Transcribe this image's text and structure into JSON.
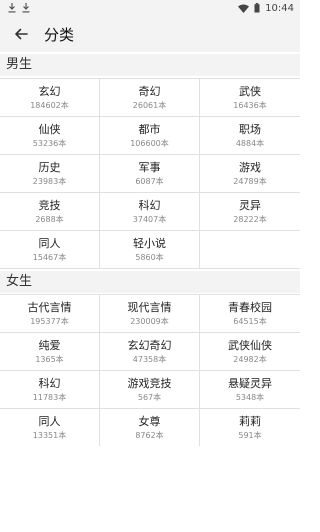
{
  "status_bar": {
    "time": "10:44",
    "icons": [
      "download-icon",
      "download-icon",
      "wifi-icon",
      "battery-icon"
    ]
  },
  "header": {
    "back_icon": "back-arrow-icon",
    "title": "分类"
  },
  "sections": [
    {
      "title": "男生",
      "items": [
        {
          "name": "玄幻",
          "count": "184602本"
        },
        {
          "name": "奇幻",
          "count": "26061本"
        },
        {
          "name": "武侠",
          "count": "16436本"
        },
        {
          "name": "仙侠",
          "count": "53236本"
        },
        {
          "name": "都市",
          "count": "106600本"
        },
        {
          "name": "职场",
          "count": "4884本"
        },
        {
          "name": "历史",
          "count": "23983本"
        },
        {
          "name": "军事",
          "count": "6087本"
        },
        {
          "name": "游戏",
          "count": "24789本"
        },
        {
          "name": "竞技",
          "count": "2688本"
        },
        {
          "name": "科幻",
          "count": "37407本"
        },
        {
          "name": "灵异",
          "count": "28222本"
        },
        {
          "name": "同人",
          "count": "15467本"
        },
        {
          "name": "轻小说",
          "count": "5860本"
        }
      ]
    },
    {
      "title": "女生",
      "items": [
        {
          "name": "古代言情",
          "count": "195377本"
        },
        {
          "name": "现代言情",
          "count": "230009本"
        },
        {
          "name": "青春校园",
          "count": "64515本"
        },
        {
          "name": "纯爱",
          "count": "1365本"
        },
        {
          "name": "玄幻奇幻",
          "count": "47358本"
        },
        {
          "name": "武侠仙侠",
          "count": "24982本"
        },
        {
          "name": "科幻",
          "count": "11783本"
        },
        {
          "name": "游戏竞技",
          "count": "567本"
        },
        {
          "name": "悬疑灵异",
          "count": "5348本"
        },
        {
          "name": "同人",
          "count": "13351本"
        },
        {
          "name": "女尊",
          "count": "8762本"
        },
        {
          "name": "莉莉",
          "count": "591本"
        }
      ]
    }
  ]
}
